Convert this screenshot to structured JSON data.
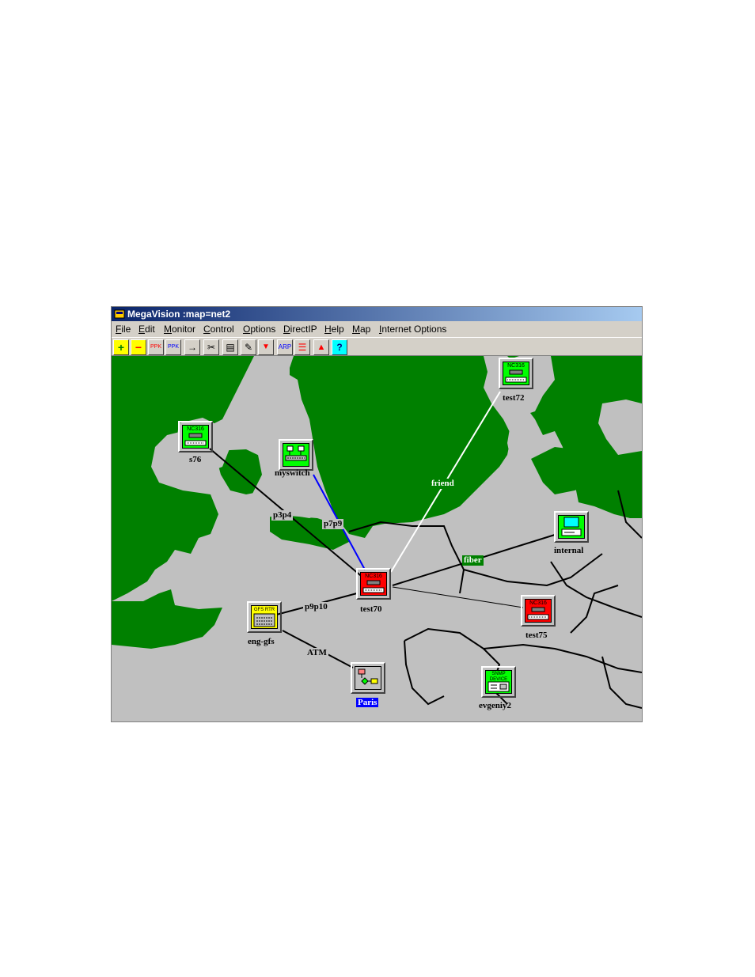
{
  "window": {
    "title": "MegaVision :map=net2"
  },
  "menu": [
    "File",
    "Edit",
    "Monitor",
    "Control",
    "Options",
    "DirectIP",
    "Help",
    "Map",
    "Internet Options"
  ],
  "toolbar": [
    {
      "icon": "add-folder-icon",
      "text": "+"
    },
    {
      "icon": "remove-folder-icon",
      "text": "−"
    },
    {
      "icon": "ppk-icon",
      "text": "PPK"
    },
    {
      "icon": "ppk-cross-icon",
      "text": "PPK"
    },
    {
      "icon": "connect-arrow-icon",
      "text": "→"
    },
    {
      "icon": "cut-icon",
      "text": "✂"
    },
    {
      "icon": "paste-icon",
      "text": "▤"
    },
    {
      "icon": "edit-note-icon",
      "text": "✎"
    },
    {
      "icon": "filter-icon",
      "text": "▼"
    },
    {
      "icon": "arp-icon",
      "text": "ARP"
    },
    {
      "icon": "list-icon",
      "text": "☰"
    },
    {
      "icon": "alarm-icon",
      "text": "▲"
    },
    {
      "icon": "help-icon",
      "text": "?"
    }
  ],
  "colors": {
    "land_green": "#008000",
    "land_gray": "#c0c0c0",
    "node_green": "#00ff00",
    "node_red": "#ff0000",
    "node_yellow": "#ffff00",
    "node_gray": "#c0c0c0"
  },
  "nodes": {
    "test72": {
      "label": "test72",
      "badge": "NC316",
      "status": "green"
    },
    "s76": {
      "label": "s76",
      "badge": "NC316",
      "status": "green"
    },
    "myswitch": {
      "label": "myswitch",
      "badge": "",
      "status": "green"
    },
    "internal": {
      "label": "internal",
      "badge": "",
      "status": "green"
    },
    "test70": {
      "label": "test70",
      "badge": "NC316",
      "status": "red"
    },
    "test75": {
      "label": "test75",
      "badge": "NC316",
      "status": "red"
    },
    "eng_gfs": {
      "label": "eng-gfs",
      "badge": "GFS RTR",
      "status": "yellow"
    },
    "paris": {
      "label": "Paris",
      "badge": "",
      "status": "gray"
    },
    "evgeniy2": {
      "label": "evgeniy2",
      "badge": "SNMP DEVICE",
      "status": "green"
    }
  },
  "links": {
    "friend": "friend",
    "p3p4": "p3p4",
    "p7p9": "p7p9",
    "fiber": "fiber",
    "p9p10": "p9p10",
    "atm": "ATM"
  }
}
